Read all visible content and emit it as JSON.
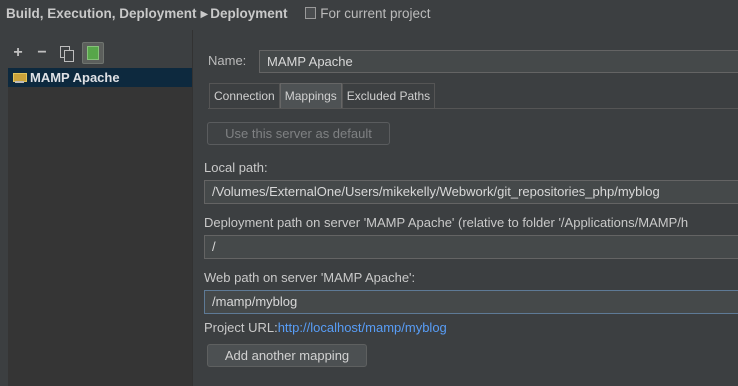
{
  "breadcrumb": {
    "path1": "Build, Execution, Deployment",
    "path2": "Deployment",
    "scope": "For current project"
  },
  "toolbar": {
    "add": "+",
    "remove": "−",
    "copy_icon": "copy-icon",
    "default_icon": "use-as-default-icon"
  },
  "tree": {
    "items": [
      {
        "label": "MAMP Apache",
        "icon": "server-icon"
      }
    ]
  },
  "form": {
    "name_label": "Name:",
    "name_value": "MAMP Apache",
    "tabs": [
      "Connection",
      "Mappings",
      "Excluded Paths"
    ],
    "active_tab": "Mappings",
    "use_default_button": "Use this server as default",
    "local_path_label": "Local path:",
    "local_path_value": "/Volumes/ExternalOne/Users/mikekelly/Webwork/git_repositories_php/myblog",
    "deploy_path_label": "Deployment path on server 'MAMP Apache' (relative to folder '/Applications/MAMP/h",
    "deploy_path_value": "/",
    "web_path_label": "Web path on server 'MAMP Apache':",
    "web_path_value": "/mamp/myblog",
    "project_url_label": "Project URL:",
    "project_url_value": "http://localhost/mamp/myblog",
    "add_mapping_button": "Add another mapping"
  },
  "colors": {
    "background": "#3c3f41",
    "selection": "#0d293e",
    "link": "#589df6"
  }
}
